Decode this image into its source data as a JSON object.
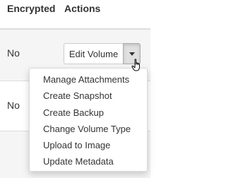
{
  "table": {
    "headers": {
      "encrypted": "Encrypted",
      "actions": "Actions"
    },
    "rows": [
      {
        "encrypted": "No",
        "action_button": "Edit Volume"
      },
      {
        "encrypted": "No"
      }
    ]
  },
  "dropdown": {
    "items": [
      "Manage Attachments",
      "Create Snapshot",
      "Create Backup",
      "Change Volume Type",
      "Upload to Image",
      "Update Metadata"
    ]
  },
  "icons": {
    "caret": "chevron-down-icon",
    "cursor": "hand-pointer-cursor-icon"
  },
  "colors": {
    "header_border": "#dddddd",
    "row_stripe": "#f5f5f5",
    "caret_active_bg": "#e0e0e0",
    "text": "#333333"
  }
}
